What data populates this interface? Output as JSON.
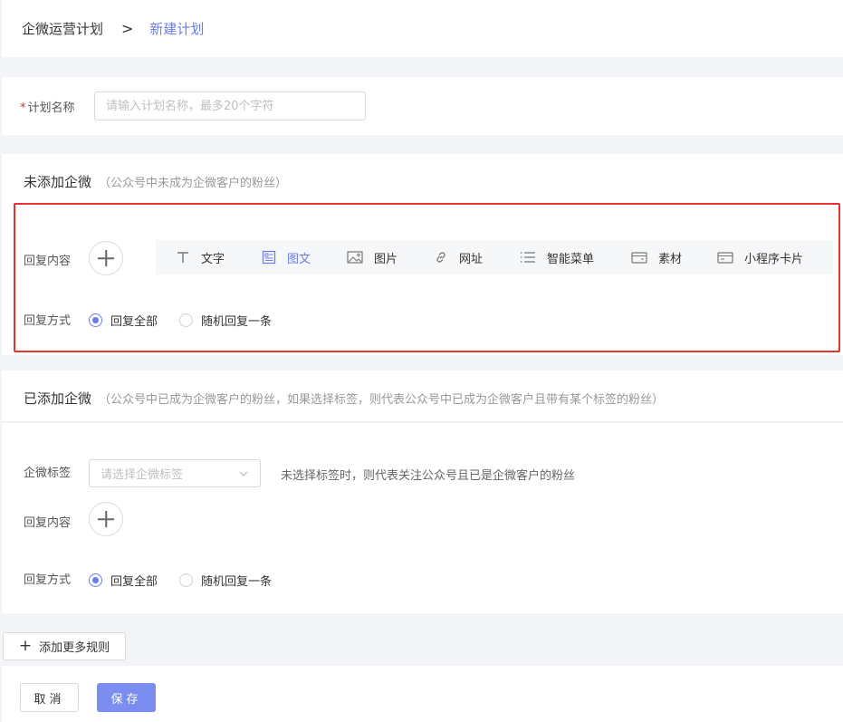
{
  "breadcrumb": {
    "root": "企微运营计划",
    "separator": ">",
    "current": "新建计划"
  },
  "plan_name": {
    "label": "计划名称",
    "required_mark": "*",
    "placeholder": "请输入计划名称，最多20个字符",
    "value": ""
  },
  "section_not_added": {
    "title": "未添加企微",
    "description": "（公众号中未成为企微客户的粉丝）",
    "reply_content_label": "回复内容",
    "toolbar": [
      {
        "label": "文字",
        "icon": "text-icon"
      },
      {
        "label": "图文",
        "icon": "article-icon",
        "active": true
      },
      {
        "label": "图片",
        "icon": "image-icon"
      },
      {
        "label": "网址",
        "icon": "link-icon"
      },
      {
        "label": "智能菜单",
        "icon": "menu-list-icon"
      },
      {
        "label": "素材",
        "icon": "material-icon"
      },
      {
        "label": "小程序卡片",
        "icon": "mini-program-card-icon"
      }
    ],
    "reply_mode_label": "回复方式",
    "reply_mode_options": [
      "回复全部",
      "随机回复一条"
    ],
    "reply_mode_selected": "回复全部"
  },
  "section_added": {
    "title": "已添加企微",
    "description": "（公众号中已成为企微客户的粉丝，如果选择标签，则代表公众号中已成为企微客户且带有某个标签的粉丝）",
    "tag_label": "企微标签",
    "tag_placeholder": "请选择企微标签",
    "tag_hint": "未选择标签时，则代表关注公众号且已是企微客户的粉丝",
    "reply_content_label": "回复内容",
    "reply_mode_label": "回复方式",
    "reply_mode_options": [
      "回复全部",
      "随机回复一条"
    ],
    "reply_mode_selected": "回复全部"
  },
  "actions": {
    "add_more_rules": "添加更多规则",
    "cancel": "取消",
    "save": "保存"
  },
  "colors": {
    "accent": "#6b7ce8",
    "save_button": "#7b8ef0",
    "highlight_border": "#e8322f"
  }
}
